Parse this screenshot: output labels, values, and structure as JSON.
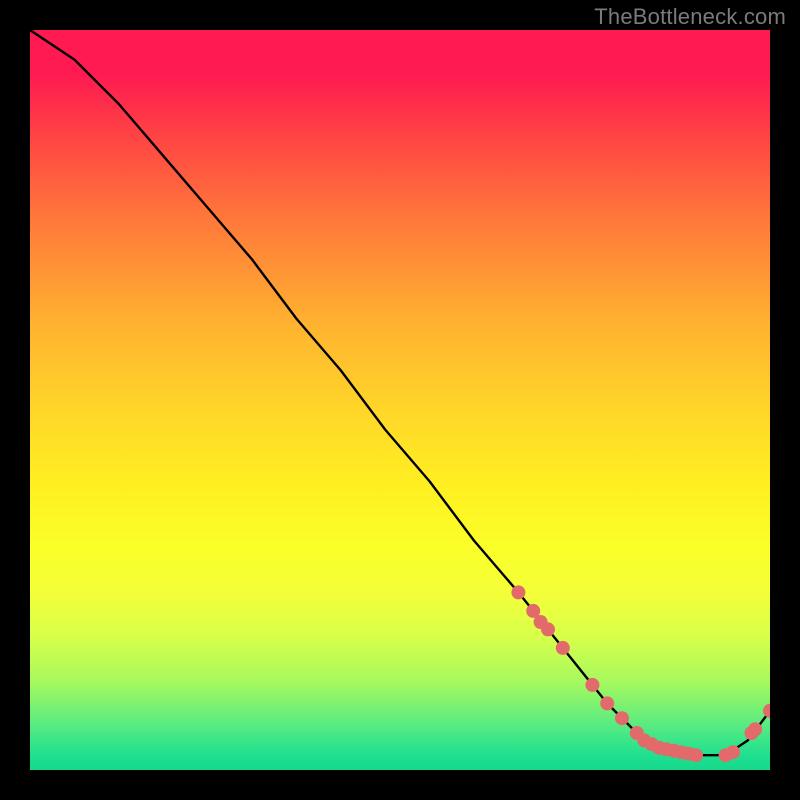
{
  "watermark": "TheBottleneck.com",
  "chart_data": {
    "type": "line",
    "title": "",
    "xlabel": "",
    "ylabel": "",
    "xlim": [
      0,
      100
    ],
    "ylim": [
      0,
      100
    ],
    "series": [
      {
        "name": "curve",
        "x": [
          0,
          6,
          12,
          18,
          24,
          30,
          36,
          42,
          48,
          54,
          60,
          66,
          70,
          74,
          78,
          82,
          86,
          90,
          94,
          97,
          100
        ],
        "y": [
          100,
          96,
          90,
          83,
          76,
          69,
          61,
          54,
          46,
          39,
          31,
          24,
          19,
          14,
          9,
          5,
          3,
          2,
          2,
          4,
          8
        ]
      },
      {
        "name": "markers",
        "x": [
          66,
          68,
          69,
          70,
          72,
          76,
          78,
          80,
          82,
          83,
          84,
          85,
          86,
          87,
          88,
          89,
          90,
          94,
          95,
          97.5,
          98,
          100
        ],
        "y": [
          24,
          21.5,
          20,
          19,
          16.5,
          11.5,
          9,
          7,
          5,
          4,
          3.5,
          3,
          2.8,
          2.6,
          2.4,
          2.2,
          2,
          2,
          2.4,
          5,
          5.5,
          8
        ]
      }
    ],
    "colors": {
      "curve": "#000000",
      "markers": "#e36a6a"
    }
  }
}
